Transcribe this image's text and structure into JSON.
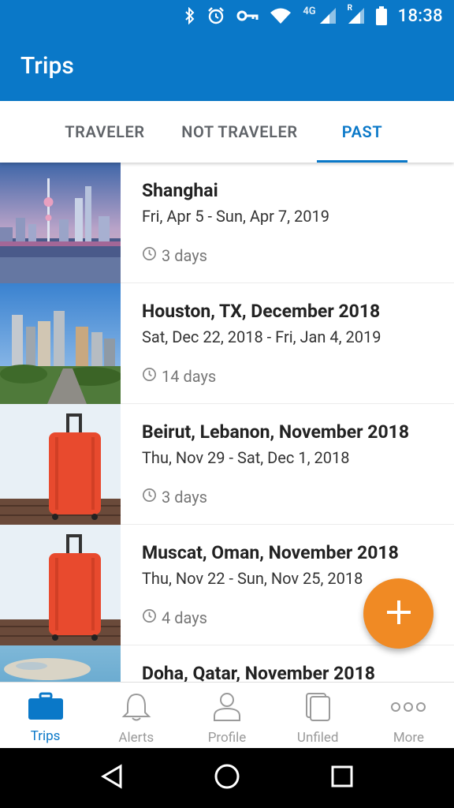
{
  "status_bar": {
    "network_label": "4G",
    "roaming_label": "R",
    "time": "18:38"
  },
  "app_bar": {
    "title": "Trips"
  },
  "tabs": [
    {
      "label": "TRAVELER",
      "active": false
    },
    {
      "label": "NOT TRAVELER",
      "active": false
    },
    {
      "label": "PAST",
      "active": true
    }
  ],
  "trips": [
    {
      "name": "Shanghai",
      "dates": "Fri, Apr 5 - Sun, Apr 7, 2019",
      "duration": "3 days",
      "image": "city-skyline-shanghai"
    },
    {
      "name": "Houston, TX, December 2018",
      "dates": "Sat, Dec 22, 2018 - Fri, Jan 4, 2019",
      "duration": "14 days",
      "image": "city-skyline-houston"
    },
    {
      "name": "Beirut, Lebanon, November 2018",
      "dates": "Thu, Nov 29 - Sat, Dec 1, 2018",
      "duration": "3 days",
      "image": "red-suitcase"
    },
    {
      "name": "Muscat, Oman, November 2018",
      "dates": "Thu, Nov 22 - Sun, Nov 25, 2018",
      "duration": "4 days",
      "image": "red-suitcase"
    },
    {
      "name": "Doha, Qatar, November 2018",
      "dates": "",
      "duration": "",
      "image": "coastal-aerial-doha"
    }
  ],
  "fab": {
    "icon": "plus-icon"
  },
  "bottom_nav": [
    {
      "label": "Trips",
      "icon": "briefcase-icon",
      "active": true
    },
    {
      "label": "Alerts",
      "icon": "bell-icon",
      "active": false
    },
    {
      "label": "Profile",
      "icon": "person-icon",
      "active": false
    },
    {
      "label": "Unfiled",
      "icon": "documents-icon",
      "active": false
    },
    {
      "label": "More",
      "icon": "more-dots-icon",
      "active": false
    }
  ],
  "colors": {
    "primary": "#0a78c8",
    "accent": "#f08a24",
    "nav_inactive": "#9a9a9a"
  }
}
